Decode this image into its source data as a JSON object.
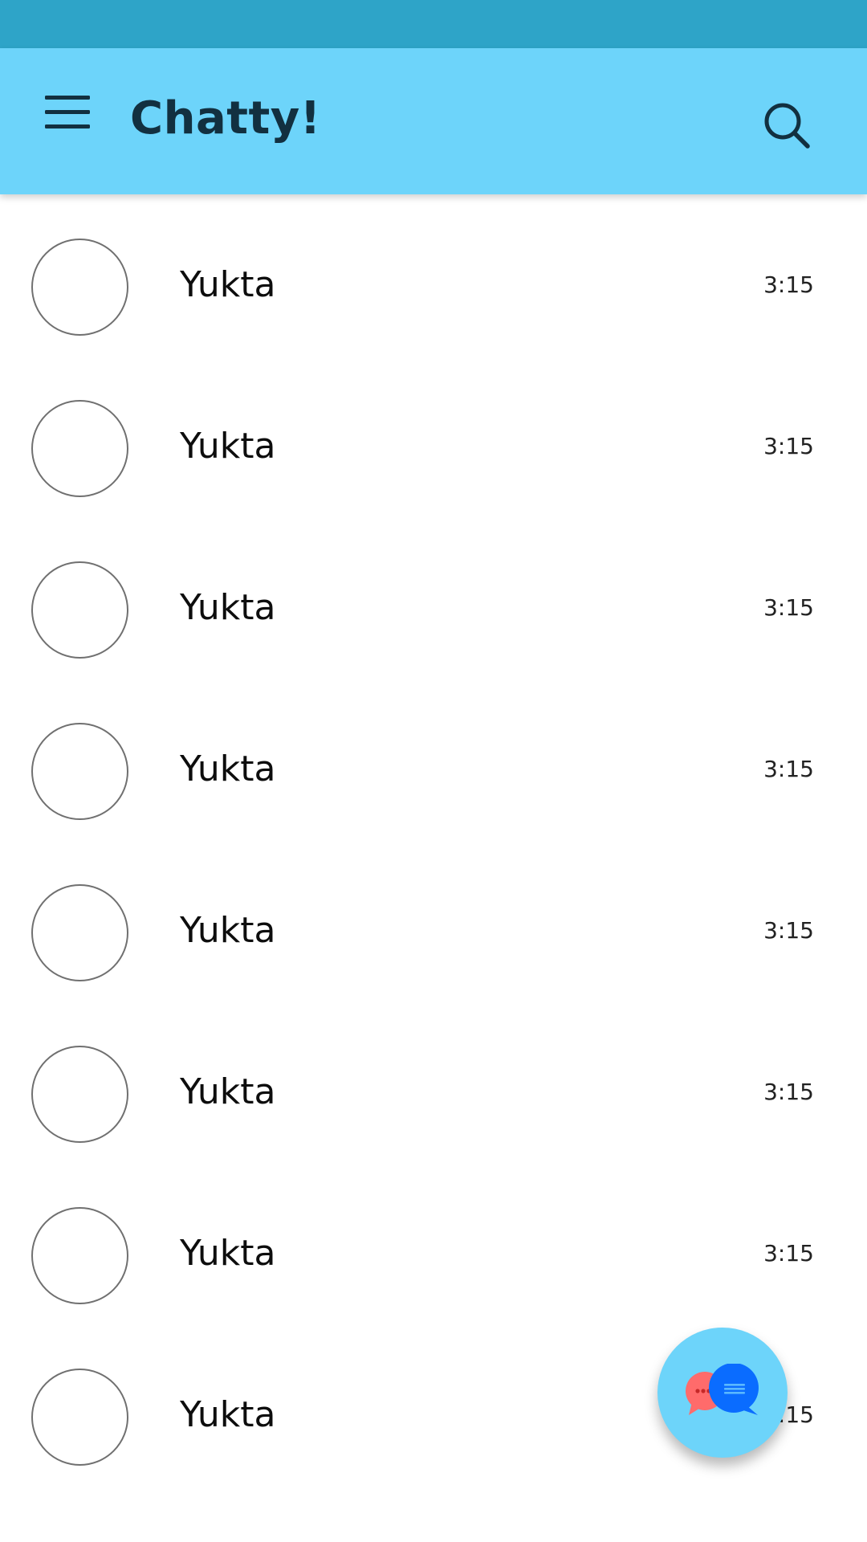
{
  "app": {
    "title": "Chatty!"
  },
  "colors": {
    "status_bar": "#2ea4c8",
    "app_bar": "#6dd4fa",
    "title_text": "#123040",
    "avatar_border": "#707070",
    "fab_bubble_back": "#ff6b6b",
    "fab_bubble_front": "#0a6cff"
  },
  "icons": {
    "menu": "menu-icon",
    "search": "search-icon",
    "fab": "chat-bubbles-icon"
  },
  "chats": [
    {
      "name": "Yukta",
      "time": "3:15"
    },
    {
      "name": "Yukta",
      "time": "3:15"
    },
    {
      "name": "Yukta",
      "time": "3:15"
    },
    {
      "name": "Yukta",
      "time": "3:15"
    },
    {
      "name": "Yukta",
      "time": "3:15"
    },
    {
      "name": "Yukta",
      "time": "3:15"
    },
    {
      "name": "Yukta",
      "time": "3:15"
    },
    {
      "name": "Yukta",
      "time": "3:15"
    }
  ]
}
